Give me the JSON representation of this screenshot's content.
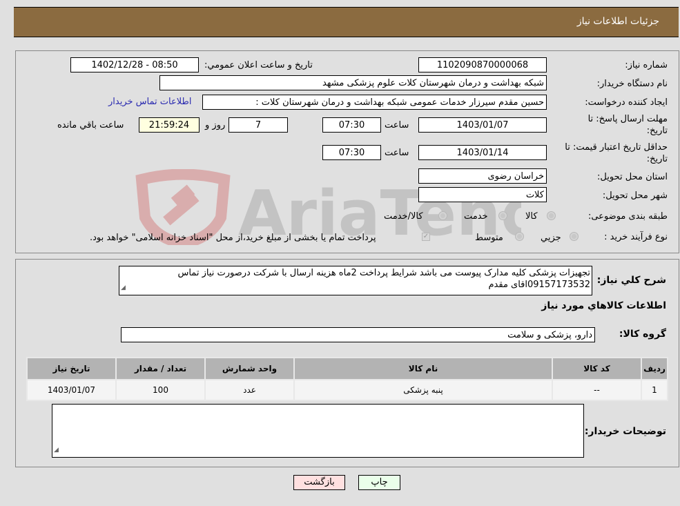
{
  "header": {
    "title": "جزئيات اطلاعات نياز"
  },
  "form": {
    "need_number_label": "شماره نياز:",
    "need_number": "1102090870000068",
    "announce_label": "تاريخ و ساعت اعلان عمومي:",
    "announce_value": "1402/12/28 - 08:50",
    "buyer_org_label": "نام دستگاه خريدار:",
    "buyer_org": "شبکه بهداشت و درمان شهرستان کلات   علوم پزشکی مشهد",
    "creator_label": "ايجاد کننده درخواست:",
    "creator": "حسین مقدم سیرزار خدمات عمومی شبکه بهداشت و درمان شهرستان کلات  :",
    "contact_link": "اطلاعات تماس خريدار",
    "reply_deadline_label_1": "مهلت ارسال پاسخ: تا",
    "reply_deadline_label_2": "تاريخ:",
    "reply_date": "1403/01/07",
    "time_label": "ساعت",
    "reply_time": "07:30",
    "days_value": "7",
    "days_label": "روز و",
    "remaining_time": "21:59:24",
    "remaining_label": "ساعت باقي مانده",
    "price_validity_label_1": "حداقل تاريخ اعتبار قيمت: تا",
    "price_validity_label_2": "تاريخ:",
    "price_date": "1403/01/14",
    "price_time": "07:30",
    "province_label": "استان محل تحويل:",
    "province": "خراسان رضوی",
    "city_label": "شهر محل تحويل:",
    "city": "کلات",
    "category_label": "طبقه بندی موضوعی:",
    "category_options": [
      "کالا",
      "خدمت",
      "کالا/خدمت"
    ],
    "process_label": "نوع فرآيند خريد :",
    "process_options": [
      "جزيي",
      "متوسط"
    ],
    "payment_note": "پرداخت تمام يا بخشی از مبلغ خريد،از محل \"اسناد خزانه اسلامی\" خواهد بود."
  },
  "details": {
    "description_label": "شرح کلي نياز:",
    "description": "تجهیزات پزشکی کلیه مدارک پیوست می باشد شرایط پرداخت 2ماه هزینه ارسال با شرکت درصورت نیاز تماس 09157173532اقای مقدم",
    "items_heading": "اطلاعات کالاهاي مورد نياز",
    "group_label": "گروه کالا:",
    "group_value": "دارو، پزشکی و سلامت",
    "table": {
      "headers": [
        "رديف",
        "کد کالا",
        "نام کالا",
        "واحد شمارش",
        "تعداد / مقدار",
        "تاريخ نياز"
      ],
      "rows": [
        [
          "1",
          "--",
          "پنبه پزشکی",
          "عدد",
          "100",
          "1403/01/07"
        ]
      ]
    },
    "buyer_notes_label": "توضيحات خريدار:",
    "buyer_notes": ""
  },
  "buttons": {
    "print": "چاپ",
    "back": "بازگشت"
  },
  "watermark": {
    "text": "AriaTender.neT"
  }
}
